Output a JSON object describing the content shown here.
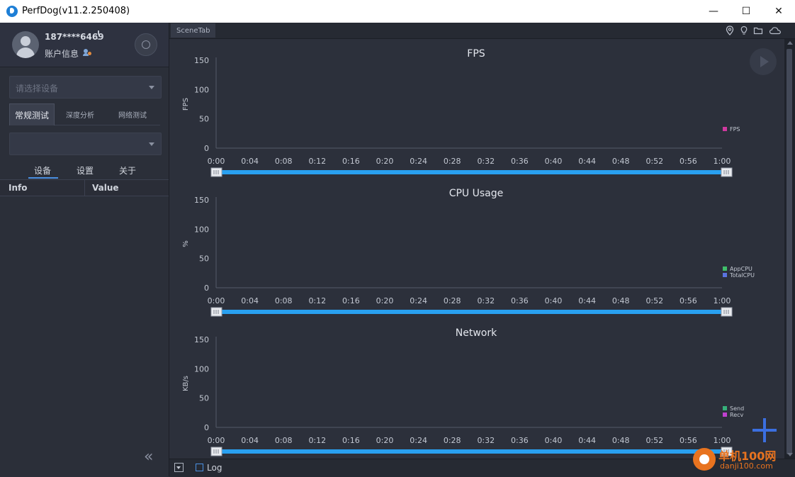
{
  "window": {
    "title": "PerfDog(v11.2.250408)",
    "controls": {
      "minimize": "—",
      "maximize": "☐",
      "close": "✕"
    }
  },
  "profile": {
    "phone": "187****6469",
    "account_label": "账户信息"
  },
  "device_select": {
    "placeholder": "请选择设备"
  },
  "mode_tabs": [
    {
      "label": "常规测试",
      "active": true
    },
    {
      "label": "深度分析",
      "active": false
    },
    {
      "label": "网络测试",
      "active": false
    }
  ],
  "app_select": {
    "value": ""
  },
  "sub_tabs": [
    {
      "label": "设备",
      "active": true
    },
    {
      "label": "设置",
      "active": false
    },
    {
      "label": "关于",
      "active": false
    }
  ],
  "info_table": {
    "headers": [
      "Info",
      "Value"
    ],
    "rows": []
  },
  "scene_tab": "SceneTab",
  "top_icons": [
    "location-pin-icon",
    "lightbulb-icon",
    "folder-icon",
    "cloud-icon"
  ],
  "bottom_bar": {
    "log_label": "Log"
  },
  "watermark": {
    "title": "单机100网",
    "subtitle": "danji100.com"
  },
  "colors": {
    "slider": "#29a0f0",
    "fps": "#d0399f",
    "app_cpu": "#3fbf6a",
    "total_cpu": "#5a73e0",
    "send": "#36b07a",
    "recv": "#c040d0",
    "plus": "#3b6fe0"
  },
  "chart_data": [
    {
      "type": "line",
      "title": "FPS",
      "ylabel": "FPS",
      "ylim": [
        0,
        150
      ],
      "yticks": [
        "150",
        "100",
        "50",
        "0"
      ],
      "xticks": [
        "0:00",
        "0:04",
        "0:08",
        "0:12",
        "0:16",
        "0:20",
        "0:24",
        "0:28",
        "0:32",
        "0:36",
        "0:40",
        "0:44",
        "0:48",
        "0:52",
        "0:56",
        "1:00"
      ],
      "series": [
        {
          "name": "FPS",
          "color": "#d0399f",
          "values": []
        }
      ],
      "legend": "right",
      "grid": false
    },
    {
      "type": "line",
      "title": "CPU Usage",
      "ylabel": "%",
      "ylim": [
        0,
        150
      ],
      "yticks": [
        "150",
        "100",
        "50",
        "0"
      ],
      "xticks": [
        "0:00",
        "0:04",
        "0:08",
        "0:12",
        "0:16",
        "0:20",
        "0:24",
        "0:28",
        "0:32",
        "0:36",
        "0:40",
        "0:44",
        "0:48",
        "0:52",
        "0:56",
        "1:00"
      ],
      "series": [
        {
          "name": "AppCPU",
          "color": "#3fbf6a",
          "values": []
        },
        {
          "name": "TotalCPU",
          "color": "#5a73e0",
          "values": []
        }
      ],
      "legend": "right",
      "grid": false
    },
    {
      "type": "line",
      "title": "Network",
      "ylabel": "KB/s",
      "ylim": [
        0,
        150
      ],
      "yticks": [
        "150",
        "100",
        "50",
        "0"
      ],
      "xticks": [
        "0:00",
        "0:04",
        "0:08",
        "0:12",
        "0:16",
        "0:20",
        "0:24",
        "0:28",
        "0:32",
        "0:36",
        "0:40",
        "0:44",
        "0:48",
        "0:52",
        "0:56",
        "1:00"
      ],
      "series": [
        {
          "name": "Send",
          "color": "#36b07a",
          "values": []
        },
        {
          "name": "Recv",
          "color": "#c040d0",
          "values": []
        }
      ],
      "legend": "right",
      "grid": false
    }
  ]
}
